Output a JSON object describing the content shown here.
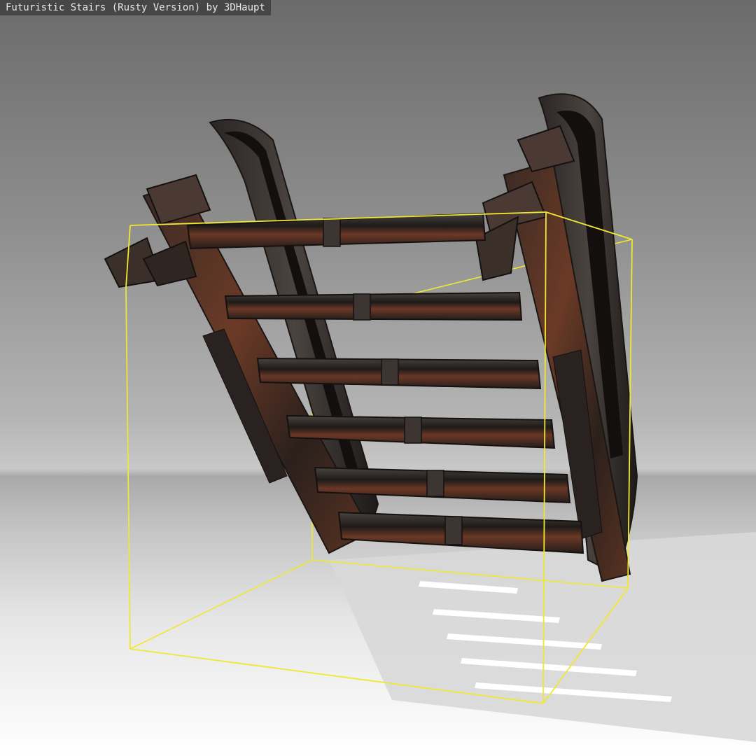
{
  "viewer": {
    "title": "Futuristic Stairs (Rusty Version) by 3DHaupt"
  },
  "scene": {
    "model": "stairs-model",
    "bounding_box_color": "#f0e830",
    "rust_color": "#6b3a26",
    "metal_dark_color": "#2a2320",
    "metal_light_color": "#5a4a42"
  }
}
